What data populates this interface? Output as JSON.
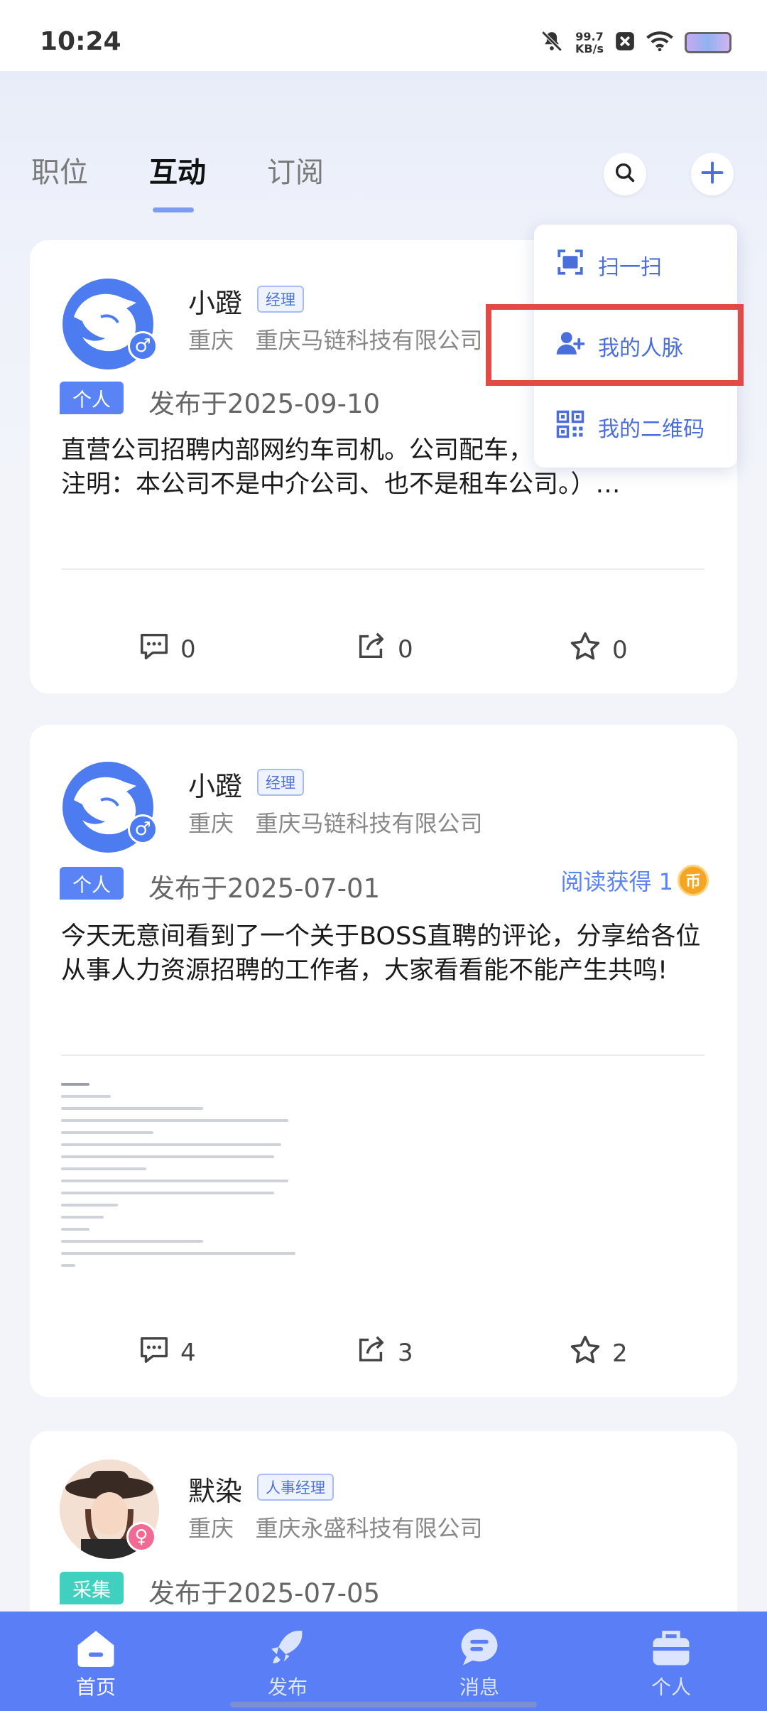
{
  "status": {
    "time": "10:24",
    "speed_value": "99.7",
    "speed_unit": "KB/s"
  },
  "tabs": [
    {
      "label": "职位"
    },
    {
      "label": "互动"
    },
    {
      "label": "订阅"
    }
  ],
  "dropdown": {
    "items": [
      {
        "label": "扫一扫"
      },
      {
        "label": "我的人脉"
      },
      {
        "label": "我的二维码"
      }
    ]
  },
  "posts": [
    {
      "name": "小蹬",
      "role": "经理",
      "location": "重庆",
      "company": "重庆马链科技有限公司",
      "tag": "个人",
      "date": "发布于2025-09-10",
      "text": "直营公司招聘内部网约车司机。公司配车，员抢单。（特别注明：本公司不是中介公司、也不是租车公司。）…",
      "comments": "0",
      "shares": "0",
      "stars": "0"
    },
    {
      "name": "小蹬",
      "role": "经理",
      "location": "重庆",
      "company": "重庆马链科技有限公司",
      "tag": "个人",
      "date": "发布于2025-07-01",
      "reward": "阅读获得 1",
      "text": "今天无意间看到了一个关于BOSS直聘的评论，分享给各位从事人力资源招聘的工作者，大家看看能不能产生共鸣!",
      "comments": "4",
      "shares": "3",
      "stars": "2"
    },
    {
      "name": "默染",
      "role": "人事经理",
      "location": "重庆",
      "company": "重庆永盛科技有限公司",
      "tag": "采集",
      "date": "发布于2025-07-05"
    }
  ],
  "nav": [
    {
      "label": "首页"
    },
    {
      "label": "发布"
    },
    {
      "label": "消息"
    },
    {
      "label": "个人"
    }
  ],
  "colors": {
    "accent": "#5a7ef5",
    "highlight": "#e04a47",
    "tag_blue": "#5a84f5",
    "tag_teal": "#3fd0c0"
  }
}
